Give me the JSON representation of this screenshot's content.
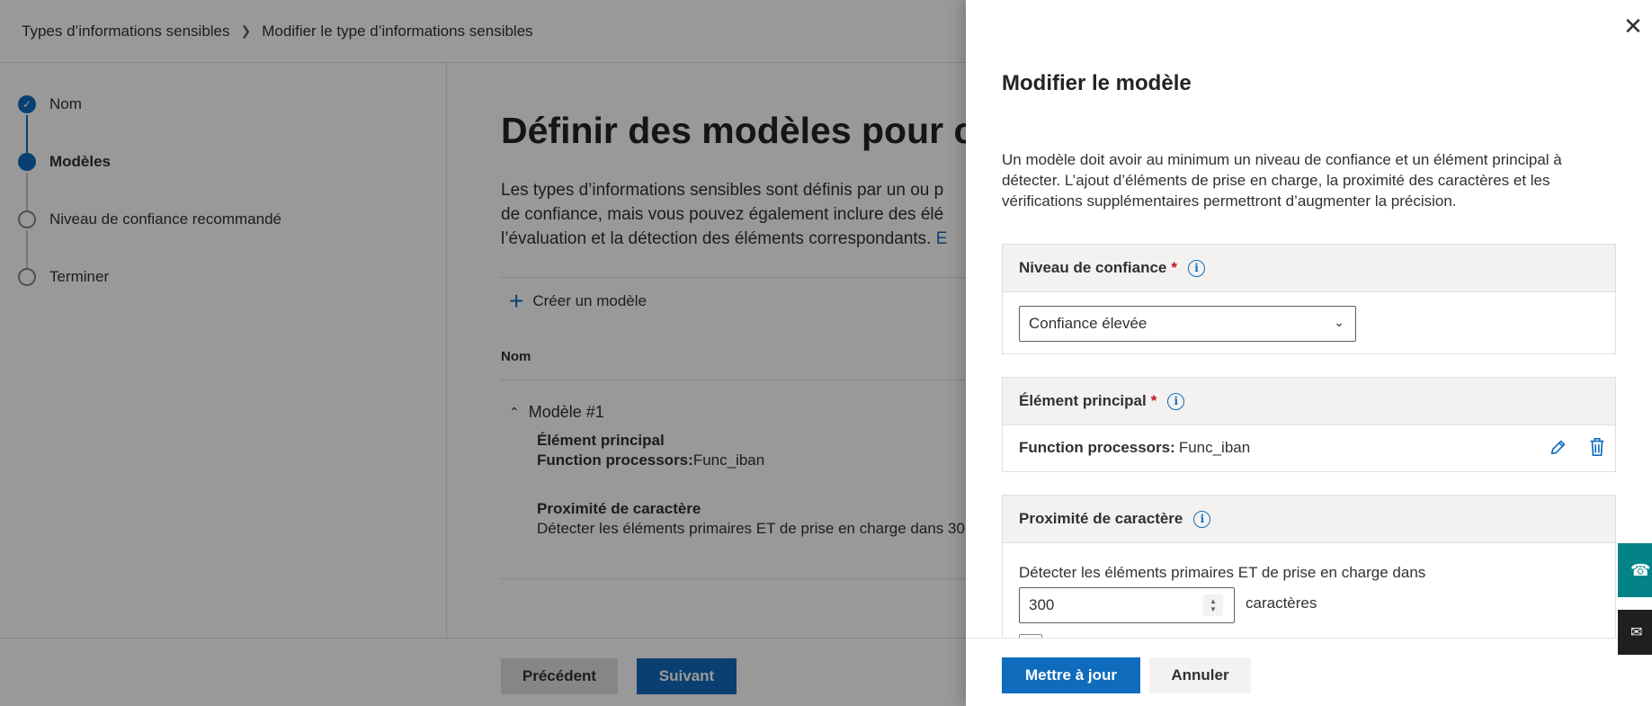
{
  "breadcrumb": {
    "item1": "Types d’informations sensibles",
    "item2": "Modifier le type d’informations sensibles"
  },
  "steps": [
    {
      "label": "Nom",
      "state": "done"
    },
    {
      "label": "Modèles",
      "state": "current"
    },
    {
      "label": "Niveau de confiance recommandé",
      "state": "pending"
    },
    {
      "label": "Terminer",
      "state": "pending"
    }
  ],
  "main": {
    "title": "Définir des modèles pour ce",
    "desc_line1": "Les types d’informations sensibles sont définis par un ou p",
    "desc_line2": "de confiance, mais vous pouvez également inclure des élé",
    "desc_line3": "l’évaluation et la détection des éléments correspondants. ",
    "desc_link": "E",
    "create_label": "Créer un modèle",
    "column_name": "Nom",
    "model_title": "Modèle #1",
    "primary_heading": "Élément principal",
    "primary_key": "Function processors:",
    "primary_value": "Func_iban",
    "proximity_heading": "Proximité de caractère",
    "proximity_text": "Détecter les éléments primaires ET de prise en charge dans 30"
  },
  "footer": {
    "prev_label": "Précédent",
    "next_label": "Suivant"
  },
  "panel": {
    "title": "Modifier le modèle",
    "desc_line1": "Un modèle doit avoir au minimum un niveau de confiance et un élément principal à",
    "desc_line2": "détecter. L’ajout d’éléments de prise en charge, la proximité des caractères et les",
    "desc_line3": "vérifications supplémentaires permettront d’augmenter la précision.",
    "confidence": {
      "heading": "Niveau de confiance",
      "required_mark": "*",
      "selected": "Confiance élevée"
    },
    "primary": {
      "heading": "Élément principal",
      "required_mark": "*",
      "key": "Function processors:",
      "value": "Func_iban"
    },
    "proximity": {
      "heading": "Proximité de caractère",
      "text": "Détecter les éléments primaires ET de prise en charge dans",
      "value": "300",
      "unit": "caractères"
    },
    "update_label": "Mettre à jour",
    "cancel_label": "Annuler"
  },
  "colors": {
    "accent": "#0f6cbd",
    "required": "#c50f1f",
    "help_button": "#038387"
  }
}
